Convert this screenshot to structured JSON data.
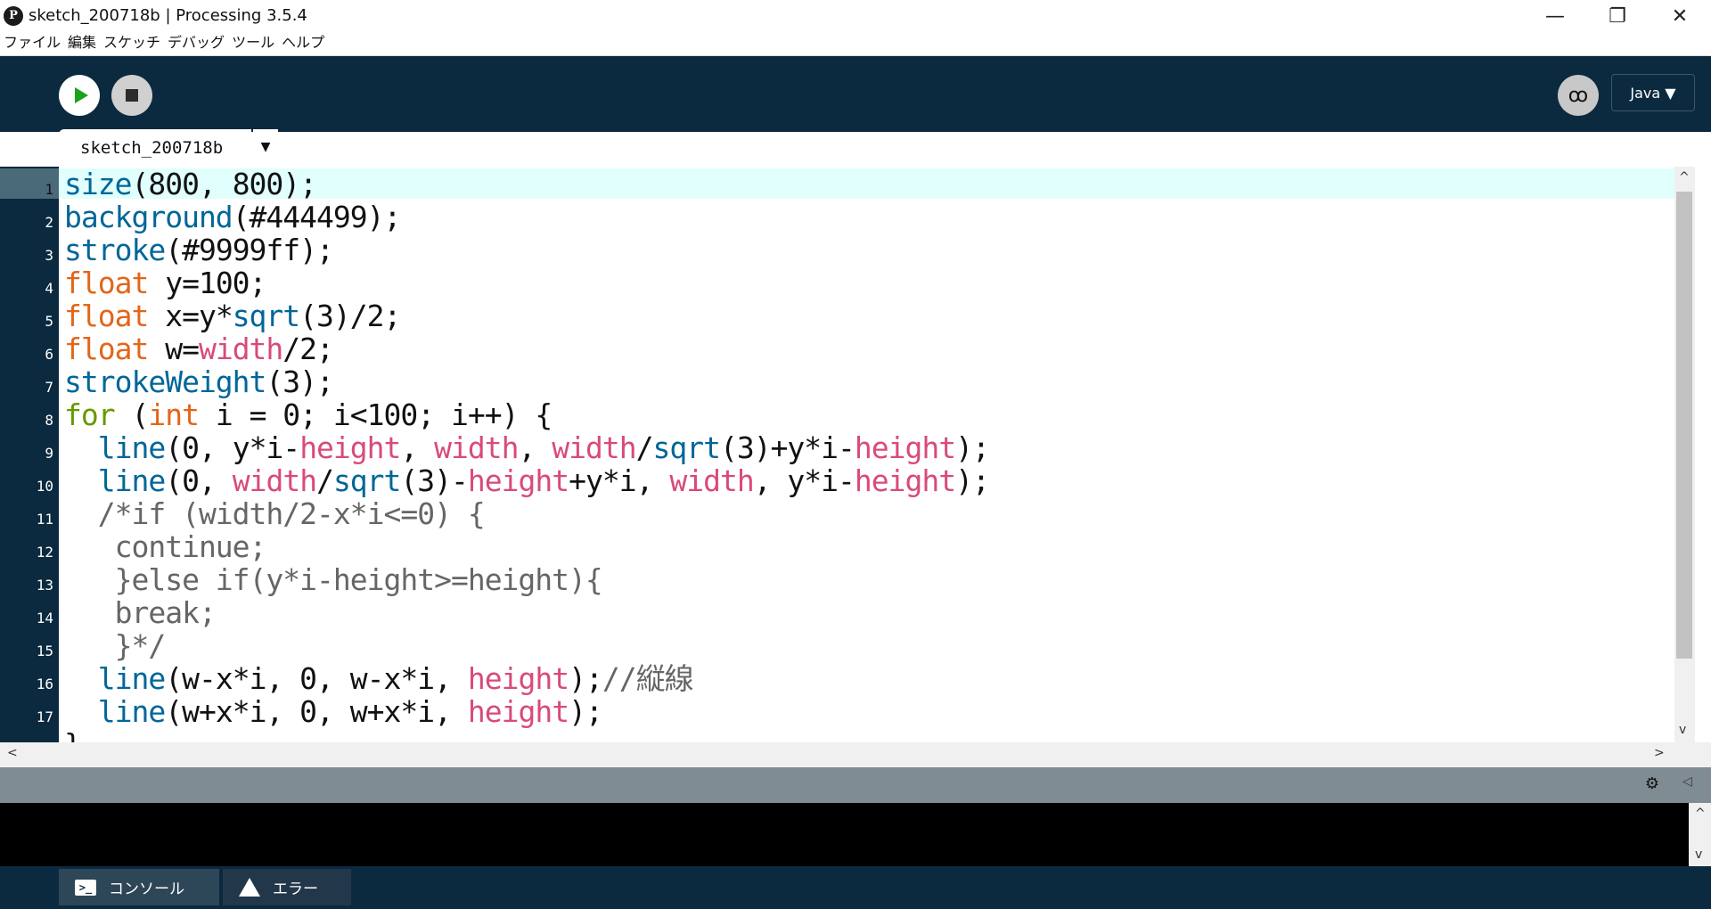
{
  "window": {
    "app_icon": "P",
    "title": "sketch_200718b | Processing 3.5.4",
    "minimize": "—",
    "maximize": "❐",
    "close": "✕"
  },
  "menu": [
    "ファイル",
    "編集",
    "スケッチ",
    "デバッグ",
    "ツール",
    "ヘルプ"
  ],
  "toolbar": {
    "debug_glyph": "ꝏ",
    "mode": "Java ▼"
  },
  "editor": {
    "tab_label": "sketch_200718b",
    "tab_arrow": "▼",
    "line_numbers": [
      "1",
      "2",
      "3",
      "4",
      "5",
      "6",
      "7",
      "8",
      "9",
      "10",
      "11",
      "12",
      "13",
      "14",
      "15",
      "16",
      "17"
    ]
  },
  "console_tabs": {
    "console": "コンソール",
    "errors": "エラー"
  },
  "colors": {
    "toolbar_bg": "#0b2a3f",
    "function": "#006699",
    "type": "#e2661a",
    "control": "#669900",
    "builtin_var": "#d94a7a",
    "comment": "#666666"
  }
}
